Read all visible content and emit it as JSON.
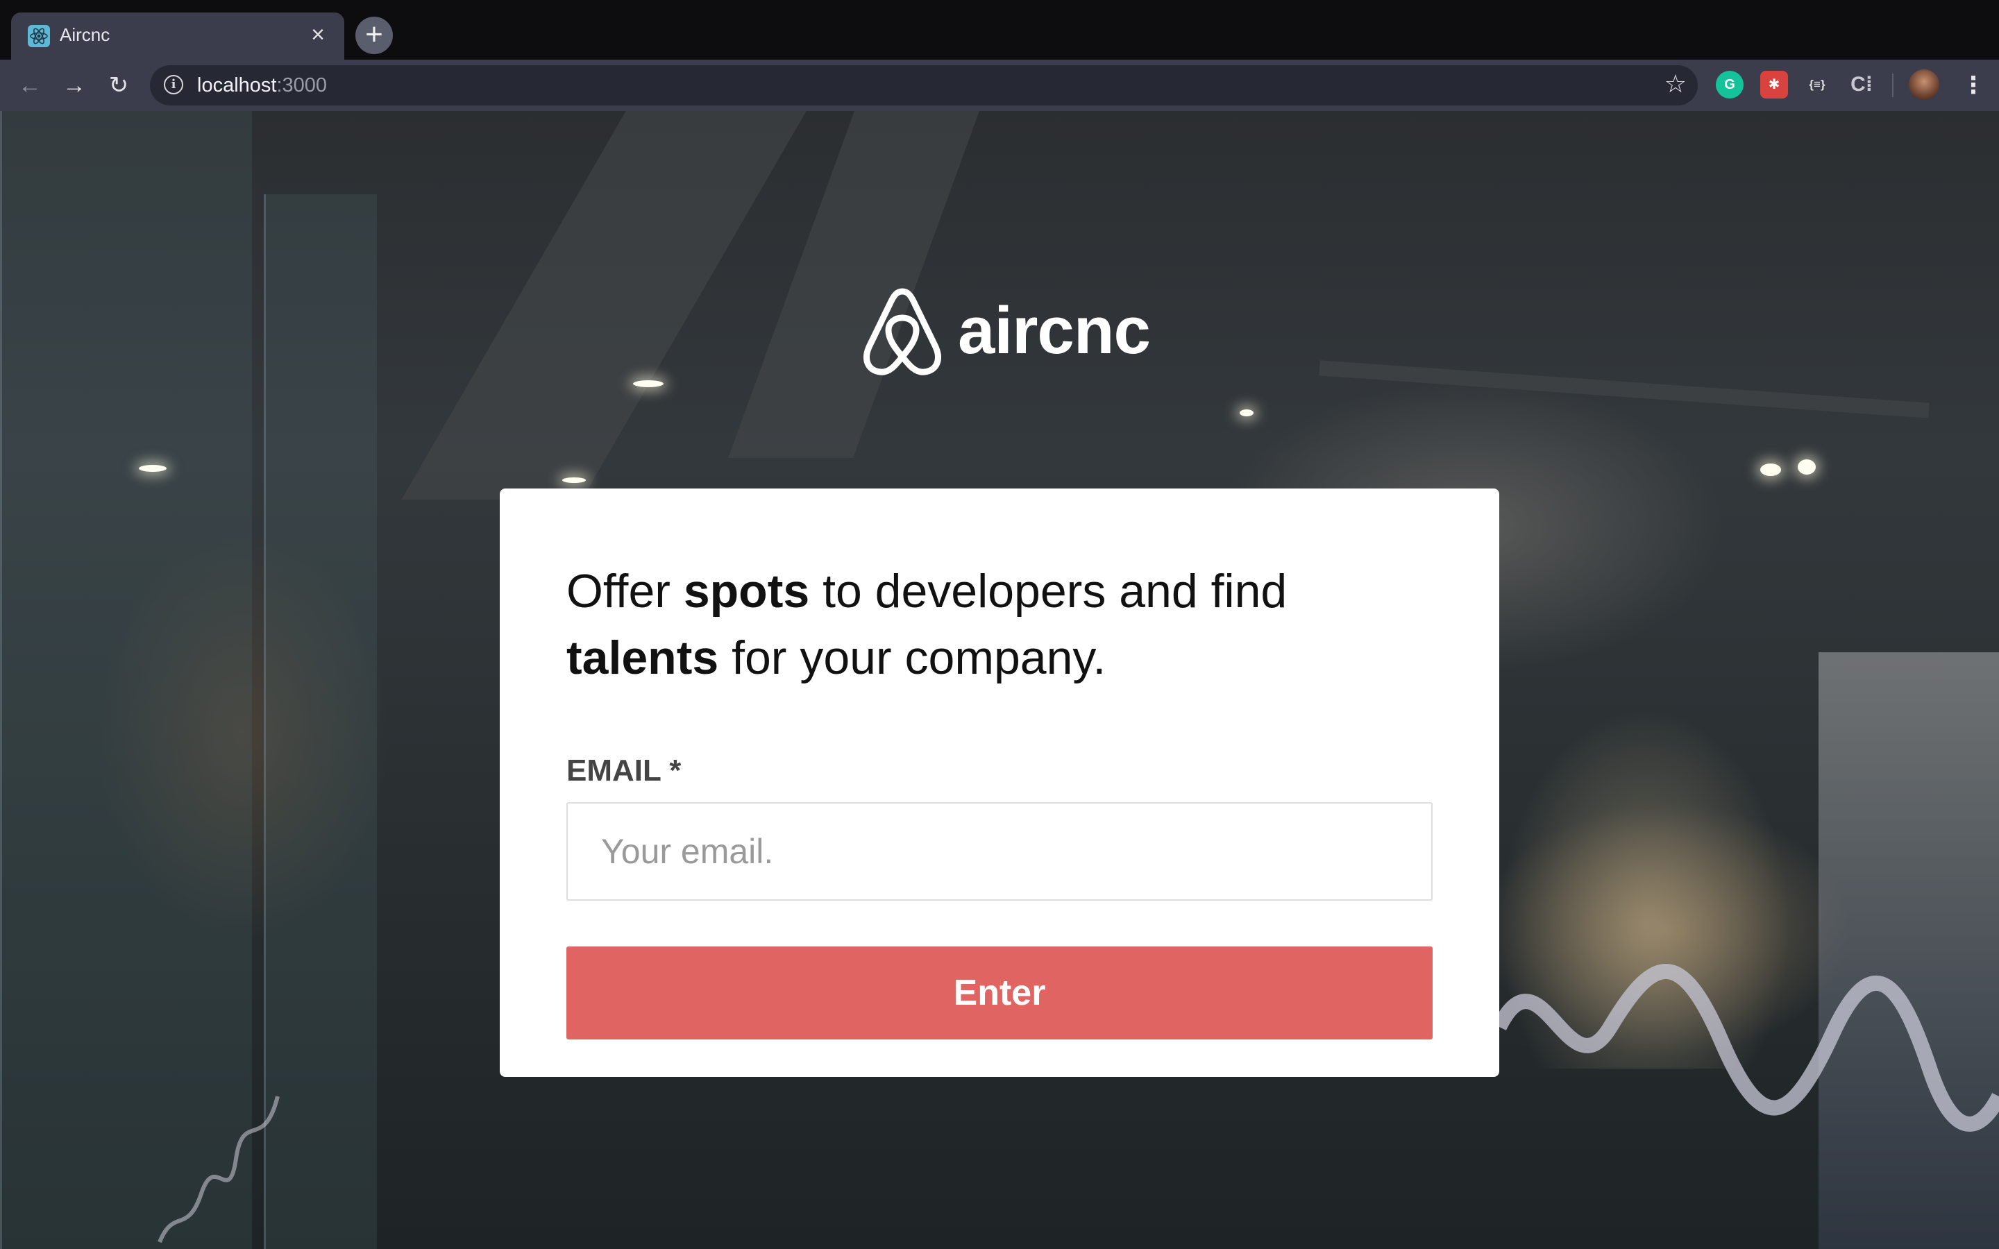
{
  "browser": {
    "tab_title": "Aircnc",
    "tab_close": "×",
    "new_tab": "+",
    "back": "←",
    "forward": "→",
    "reload": "↻",
    "info": "i",
    "url_host": "localhost",
    "url_port": ":3000",
    "star": "☆",
    "extensions": [
      {
        "icon": "grammarly-icon",
        "glyph": "G",
        "color": "#15c39a"
      },
      {
        "icon": "extension-red-icon",
        "glyph": "✱",
        "color": "#d9433f"
      },
      {
        "icon": "json-formatter-icon",
        "glyph": "{≡}",
        "color": "#3b3d4d"
      },
      {
        "icon": "extension-c-icon",
        "glyph": "C⁞",
        "color": "#3b3d4d"
      }
    ],
    "menu": "⋮"
  },
  "page": {
    "logo_text": "aircnc",
    "headline": {
      "part1": "Offer ",
      "bold1": "spots",
      "part2": " to developers and find ",
      "bold2": "talents",
      "part3": " for your company."
    },
    "email_label": "EMAIL *",
    "email_placeholder": "Your email.",
    "email_value": "",
    "submit_label": "Enter",
    "accent_color": "#e06461"
  }
}
